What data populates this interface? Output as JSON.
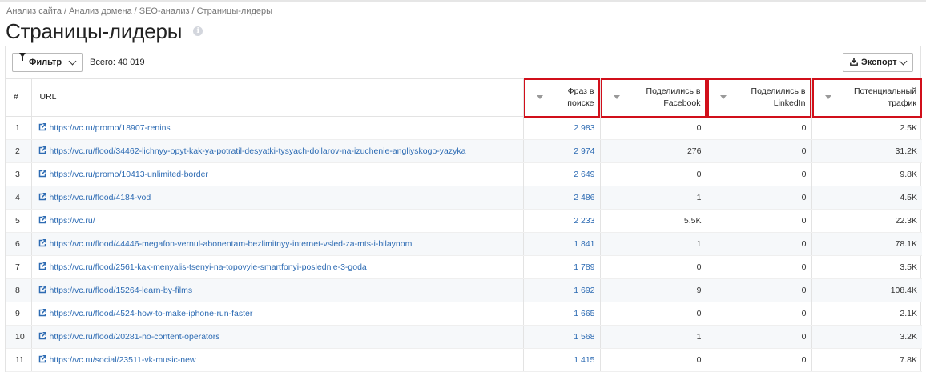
{
  "breadcrumb": {
    "items": [
      "Анализ сайта",
      "Анализ домена",
      "SEO-анализ",
      "Страницы-лидеры"
    ],
    "separator": "/"
  },
  "page": {
    "title": "Страницы-лидеры",
    "info_icon": "info-icon"
  },
  "toolbar": {
    "filter_label": "Фильтр",
    "total_label": "Всего: 40 019",
    "export_label": "Экспорт"
  },
  "table": {
    "headers": {
      "num": "#",
      "url": "URL",
      "phrases_line1": "Фраз в",
      "phrases_line2": "поиске",
      "facebook_line1": "Поделились в",
      "facebook_line2": "Facebook",
      "linkedin_line1": "Поделились в",
      "linkedin_line2": "LinkedIn",
      "traffic_line1": "Потенциальный",
      "traffic_line2": "трафик"
    },
    "highlight_color": "#d10f1a",
    "link_color": "#2d6bb3",
    "rows": [
      {
        "num": "1",
        "url": "https://vc.ru/promo/18907-renins",
        "phrases": "2 983",
        "facebook": "0",
        "linkedin": "0",
        "traffic": "2.5K"
      },
      {
        "num": "2",
        "url": "https://vc.ru/flood/34462-lichnyy-opyt-kak-ya-potratil-desyatki-tysyach-dollarov-na-izuchenie-angliyskogo-yazyka",
        "phrases": "2 974",
        "facebook": "276",
        "linkedin": "0",
        "traffic": "31.2K"
      },
      {
        "num": "3",
        "url": "https://vc.ru/promo/10413-unlimited-border",
        "phrases": "2 649",
        "facebook": "0",
        "linkedin": "0",
        "traffic": "9.8K"
      },
      {
        "num": "4",
        "url": "https://vc.ru/flood/4184-vod",
        "phrases": "2 486",
        "facebook": "1",
        "linkedin": "0",
        "traffic": "4.5K"
      },
      {
        "num": "5",
        "url": "https://vc.ru/",
        "phrases": "2 233",
        "facebook": "5.5K",
        "linkedin": "0",
        "traffic": "22.3K"
      },
      {
        "num": "6",
        "url": "https://vc.ru/flood/44446-megafon-vernul-abonentam-bezlimitnyy-internet-vsled-za-mts-i-bilaynom",
        "phrases": "1 841",
        "facebook": "1",
        "linkedin": "0",
        "traffic": "78.1K"
      },
      {
        "num": "7",
        "url": "https://vc.ru/flood/2561-kak-menyalis-tsenyi-na-topovyie-smartfonyi-poslednie-3-goda",
        "phrases": "1 789",
        "facebook": "0",
        "linkedin": "0",
        "traffic": "3.5K"
      },
      {
        "num": "8",
        "url": "https://vc.ru/flood/15264-learn-by-films",
        "phrases": "1 692",
        "facebook": "9",
        "linkedin": "0",
        "traffic": "108.4K"
      },
      {
        "num": "9",
        "url": "https://vc.ru/flood/4524-how-to-make-iphone-run-faster",
        "phrases": "1 665",
        "facebook": "0",
        "linkedin": "0",
        "traffic": "2.1K"
      },
      {
        "num": "10",
        "url": "https://vc.ru/flood/20281-no-content-operators",
        "phrases": "1 568",
        "facebook": "1",
        "linkedin": "0",
        "traffic": "3.2K"
      },
      {
        "num": "11",
        "url": "https://vc.ru/social/23511-vk-music-new",
        "phrases": "1 415",
        "facebook": "0",
        "linkedin": "0",
        "traffic": "7.8K"
      }
    ]
  }
}
